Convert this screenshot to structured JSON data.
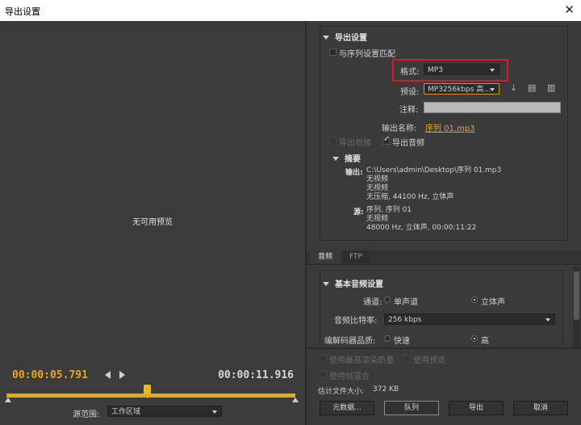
{
  "window": {
    "title": "导出设置"
  },
  "preview": {
    "no_preview_text": "无可用预览",
    "timecode_current": "00:00:05.791",
    "timecode_duration": "00:00:11.916",
    "source_range_label": "源范围:",
    "source_range_value": "工作区域",
    "playhead_fraction": 0.486
  },
  "export_settings": {
    "section_title": "导出设置",
    "match_sequence_label": "与序列设置匹配",
    "format_label": "格式:",
    "format_value": "MP3",
    "preset_label": "预设:",
    "preset_value": "MP3256kbps 高...",
    "comments_label": "注释:",
    "comments_value": "",
    "output_name_label": "输出名称:",
    "output_name_value": "序列 01.mp3",
    "export_video_label": "导出视频",
    "export_audio_label": "导出音频",
    "summary_title": "摘要",
    "summary_output_label": "输出:",
    "summary_output_lines": [
      "C:\\Users\\admin\\Desktop\\序列 01.mp3",
      "无视频",
      "无视频",
      "无压缩, 44100 Hz, 立体声"
    ],
    "summary_source_label": "源:",
    "summary_source_lines": [
      "序列, 序列 01",
      "无视频",
      "48000 Hz, 立体声, 00:00:11:22"
    ]
  },
  "tabs": [
    {
      "label": "音频"
    },
    {
      "label": "FTP"
    }
  ],
  "audio_settings": {
    "section_title": "基本音频设置",
    "channels_label": "通道:",
    "mono_label": "单声道",
    "stereo_label": "立体声",
    "bitrate_label": "音频比特率:",
    "bitrate_value": "256 kbps",
    "quality_label": "编解码器品质:",
    "fast_label": "快速",
    "high_label": "高"
  },
  "bottom": {
    "max_render_label": "使用最高渲染质量",
    "use_previews_label": "使用预览",
    "frame_blend_label": "使用帧混合",
    "file_size_label": "估计文件大小:",
    "file_size_value": "372 KB",
    "metadata_button": "元数据...",
    "queue_button": "队列",
    "export_button": "导出",
    "cancel_button": "取消"
  },
  "colors": {
    "accent": "#e8a623",
    "highlight_box": "#d71a2a",
    "panel_bg": "#3a3a3a"
  },
  "icons": [
    "close-icon",
    "save-preset-icon",
    "import-preset-icon",
    "delete-preset-icon"
  ]
}
